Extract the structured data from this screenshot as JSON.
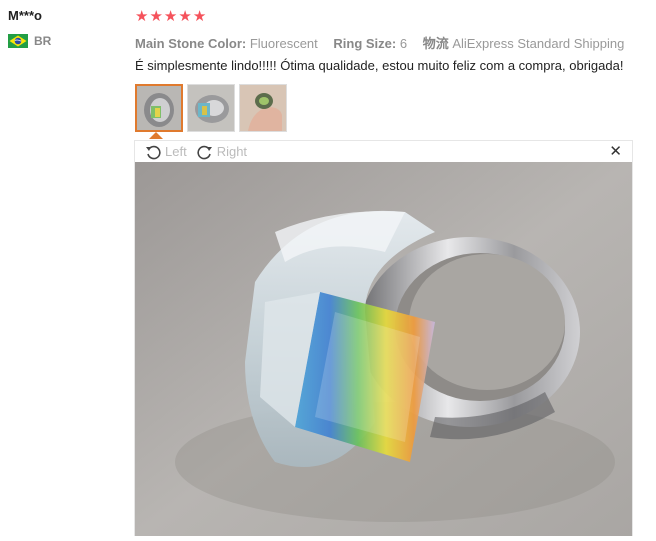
{
  "reviewer": {
    "name": "M***o",
    "country": "BR"
  },
  "rating": {
    "stars": 5,
    "max": 5
  },
  "attributes": [
    {
      "key": "Main Stone Color:",
      "value": "Fluorescent"
    },
    {
      "key": "Ring Size:",
      "value": "6"
    },
    {
      "key": "物流",
      "value": "AliExpress Standard Shipping"
    }
  ],
  "review_text": "É simplesmente lindo!!!!! Ótima qualidade, estou muito feliz com a compra, obrigada!",
  "viewer": {
    "rotate_left_label": "Left",
    "rotate_right_label": "Right",
    "close_glyph": "✕"
  },
  "icons": {
    "star": "star-icon",
    "flag": "brazil-flag-icon"
  },
  "colors": {
    "star": "#f5525b",
    "active_thumb": "#e07a2e"
  }
}
